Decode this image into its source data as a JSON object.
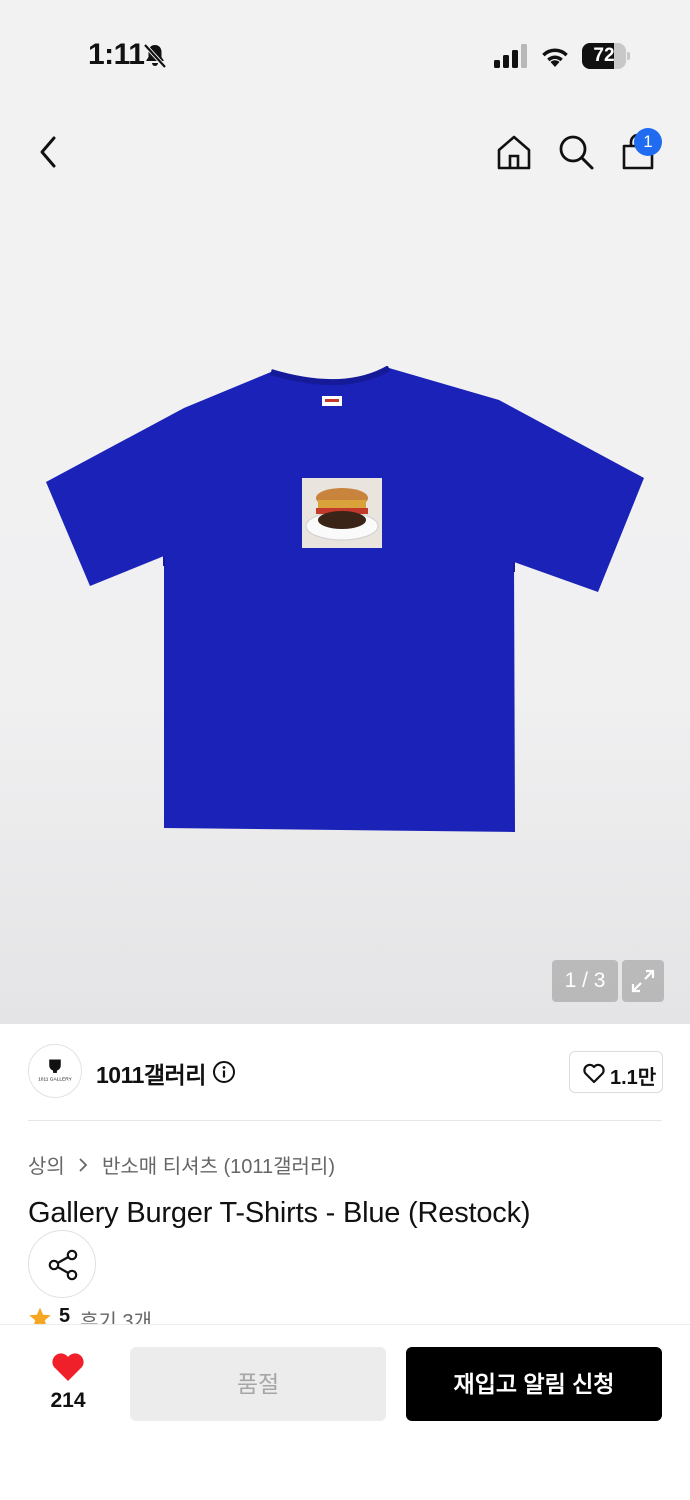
{
  "status_bar": {
    "time": "1:11",
    "battery_percent": "72",
    "battery_level": 0.72,
    "icons": [
      "bell-off-icon",
      "cellular-signal-icon",
      "wifi-icon",
      "battery-icon"
    ]
  },
  "header": {
    "icons": [
      "back-chevron-icon",
      "home-icon",
      "search-icon",
      "shopping-bag-icon"
    ],
    "cart_badge": "1"
  },
  "gallery": {
    "counter": "1 / 3",
    "image_subject": "blue t-shirt with burger photo print",
    "shirt_color": "#1b22b8"
  },
  "brand": {
    "name": "1011갤러리",
    "logo_text": "1011 GALLERY",
    "like_count": "1.1만"
  },
  "product": {
    "breadcrumb": [
      "상의",
      "반소매 티셔츠 (1011갤러리)"
    ],
    "title": "Gallery Burger T-Shirts - Blue (Restock)",
    "rating": "5",
    "review_text": "후기 3개"
  },
  "bottom_bar": {
    "wish_count": "214",
    "soldout_label": "품절",
    "restock_label": "재입고 알림 신청"
  },
  "colors": {
    "accent_badge": "#1f6cf0",
    "heart": "#f0202a",
    "star": "#f5a623",
    "primary_button": "#000000"
  }
}
